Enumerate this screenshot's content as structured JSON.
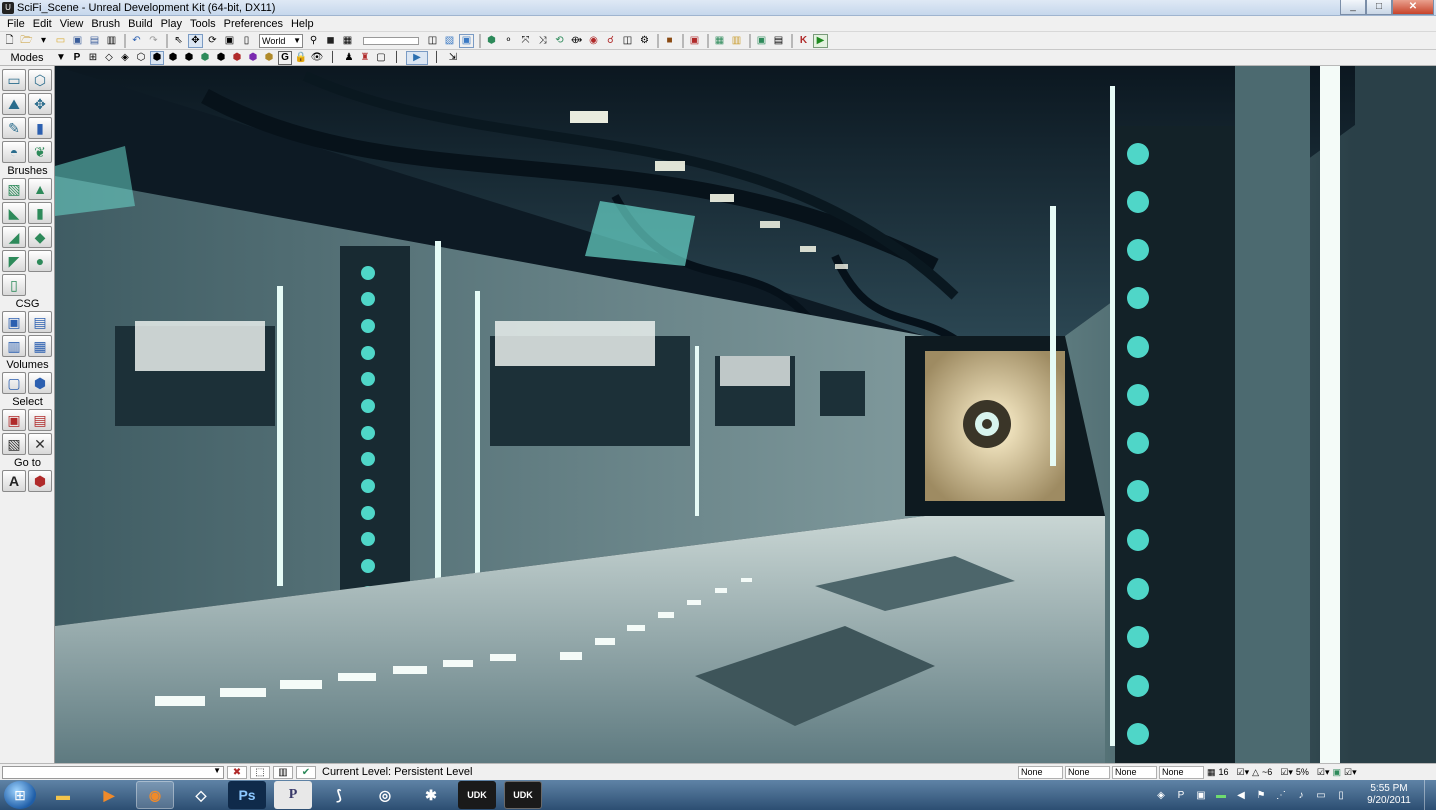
{
  "window": {
    "title": "SciFi_Scene - Unreal Development Kit (64-bit, DX11)",
    "buttons": {
      "minimize": "_",
      "maximize": "□",
      "close": "✕"
    }
  },
  "menu": [
    "File",
    "Edit",
    "View",
    "Brush",
    "Build",
    "Play",
    "Tools",
    "Preferences",
    "Help"
  ],
  "toolbar": {
    "coordinate_space": "World"
  },
  "toolbar2": {
    "modes_label": "Modes",
    "p_label": "P",
    "g_label": "G"
  },
  "left_panel": {
    "brushes_label": "Brushes",
    "csg_label": "CSG",
    "volumes_label": "Volumes",
    "select_label": "Select",
    "goto_label": "Go to"
  },
  "status": {
    "current_level": "Current Level:  Persistent Level",
    "fields": [
      "None",
      "None",
      "None",
      "None"
    ],
    "grid_value": "16",
    "rotation_value": "~6",
    "scale_value": "5%"
  },
  "taskbar": {
    "apps": [
      "Explorer",
      "Media Player",
      "Firefox",
      "Unity",
      "Photoshop",
      "Perforce",
      "Maya",
      "Blender",
      "ZBrush",
      "UDK",
      "UDK"
    ],
    "apps_labels": {
      "ps": "Ps",
      "p": "P",
      "udk1": "UDK",
      "udk2": "UDK"
    },
    "time": "5:55 PM",
    "date": "9/20/2011"
  },
  "colors": {
    "accent_teal": "#4fd6c8",
    "corridor_glow": "#e7d3a4"
  }
}
